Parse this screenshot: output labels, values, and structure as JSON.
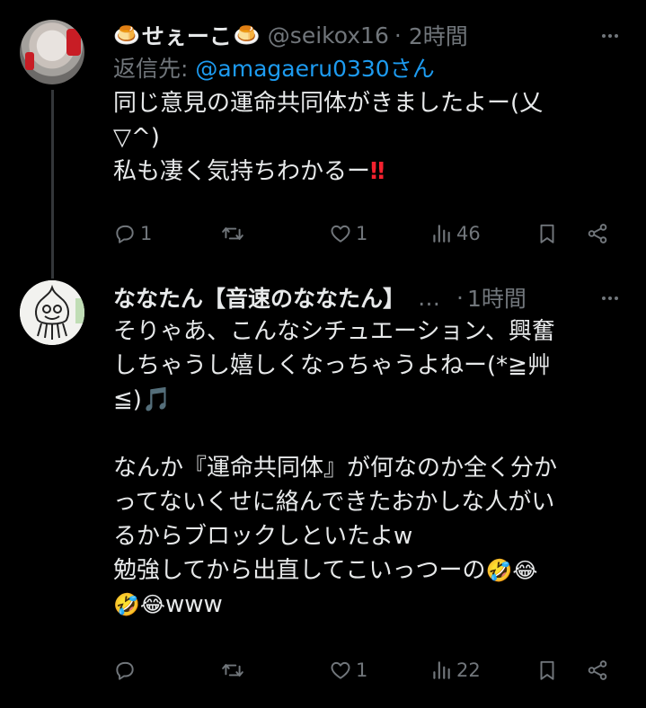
{
  "tweets": [
    {
      "name_emoji": "🍮",
      "name": "せぇーこ",
      "handle": "@seikox16",
      "separator": "·",
      "time": "2時間",
      "reply_prefix": "返信先:",
      "reply_to": "@amagaeru0330さん",
      "body_line1": "同じ意見の運命共同体がきましたよー(乂",
      "body_line2": "▽^)",
      "body_line3": "私も凄く気持ちわかるー",
      "body_line3_emoji": "‼",
      "reply_count": "1",
      "retweet_count": "",
      "like_count": "1",
      "view_count": "46"
    },
    {
      "name": "ななたん【音速のななたん】",
      "name_truncation": "…",
      "separator": "·",
      "time": "1時間",
      "body_line1": "そりゃあ、こんなシチュエーション、興奮",
      "body_line2": "しちゃうし嬉しくなっちゃうよねー(*≧艸",
      "body_line3": "≦)",
      "body_line3_emoji": "🎵",
      "body_line5": "なんか『運命共同体』が何なのか全く分か",
      "body_line6": "ってないくせに絡んできたおかしな人がい",
      "body_line7": "るからブロックしといたよw",
      "body_line8": "勉強してから出直してこいっつーの",
      "body_line8_emoji": "🤣😂",
      "body_line9_emoji": "🤣😂",
      "body_line9": "www",
      "reply_count": "",
      "retweet_count": "",
      "like_count": "1",
      "view_count": "22"
    }
  ]
}
